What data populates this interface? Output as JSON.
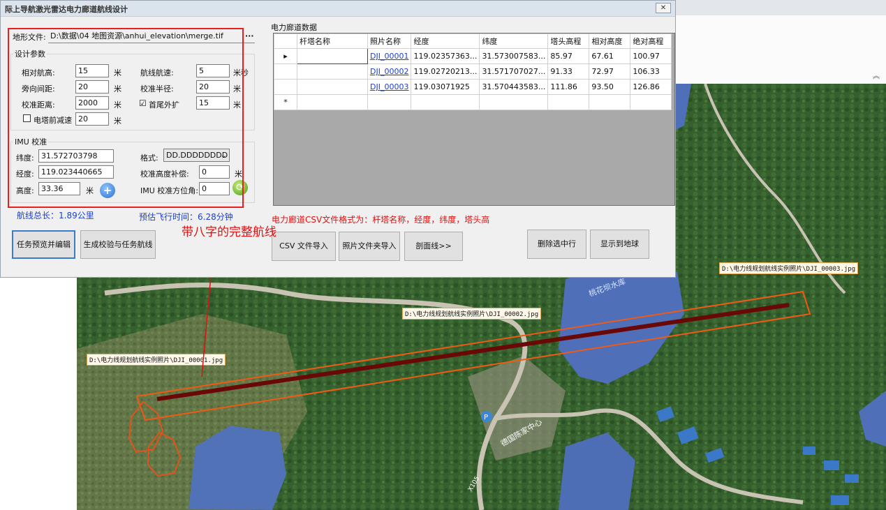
{
  "window": {
    "title": "际上导航激光雷达电力廊道航线设计",
    "close_label": "✕"
  },
  "terrain": {
    "label": "地形文件:",
    "path": "D:\\数据\\04 地图资源\\anhui_elevation\\merge.tif",
    "browse_label": "···"
  },
  "design": {
    "group_title": "设计参数",
    "rel_height_label": "相对航高:",
    "rel_height": "15",
    "rel_height_unit": "米",
    "speed_label": "航线航速:",
    "speed": "5",
    "speed_unit": "米秒",
    "side_spacing_label": "旁向间距:",
    "side_spacing": "20",
    "side_spacing_unit": "米",
    "calib_radius_label": "校准半径:",
    "calib_radius": "20",
    "calib_radius_unit": "米",
    "calib_dist_label": "校准距离:",
    "calib_dist": "2000",
    "calib_dist_unit": "米",
    "ext_label": "首尾外扩",
    "ext_checked": "☑",
    "ext_value": "15",
    "ext_unit": "米",
    "decel_label": "电塔前减速",
    "decel_value": "20",
    "decel_unit": "米"
  },
  "imu": {
    "group_title": "IMU 校准",
    "lat_label": "纬度:",
    "lat": "31.572703798",
    "lon_label": "经度:",
    "lon": "119.023440665",
    "alt_label": "高度:",
    "alt": "33.36",
    "alt_unit": "米",
    "format_label": "格式:",
    "format": "DD.DDDDDDDD",
    "alt_comp_label": "校准高度补偿:",
    "alt_comp": "0",
    "alt_comp_unit": "米",
    "heading_label": "IMU 校准方位角:",
    "heading": "0"
  },
  "summary": {
    "total_length": "航线总长：1.89公里",
    "est_time": "预估飞行时间：6.28分钟"
  },
  "buttons": {
    "preview": "任务预览并编辑",
    "generate": "生成校验与任务航线",
    "csv_import": "CSV 文件导入",
    "photo_import": "照片文件夹导入",
    "profile": "剖面线>>",
    "delete_row": "删除选中行",
    "show_globe": "显示到地球"
  },
  "grid": {
    "title": "电力廊道数据",
    "columns": [
      "杆塔名称",
      "照片名称",
      "经度",
      "纬度",
      "塔头高程",
      "相对高度",
      "绝对高程"
    ],
    "rows": [
      {
        "marker": "▸",
        "tower": "",
        "photo": "DJI_00001",
        "lon": "119.02357363...",
        "lat": "31.573007583...",
        "head": "85.97",
        "rel": "67.61",
        "abs": "100.97"
      },
      {
        "marker": "",
        "tower": "",
        "photo": "DJI_00002",
        "lon": "119.02720213...",
        "lat": "31.571707027...",
        "head": "91.33",
        "rel": "72.97",
        "abs": "106.33"
      },
      {
        "marker": "",
        "tower": "",
        "photo": "DJI_00003",
        "lon": "119.03071925",
        "lat": "31.570443583...",
        "head": "111.86",
        "rel": "93.50",
        "abs": "126.86"
      }
    ],
    "new_row_marker": "*"
  },
  "csv_note": "电力廊道CSV文件格式为：杆塔名称，经度，纬度，塔头高",
  "annotation": "带八字的完整航线",
  "map": {
    "photo_labels": [
      "D:\\电力线规划航线实例照片\\DJI_00001.jpg",
      "D:\\电力线规划航线实例照片\\DJI_00002.jpg",
      "D:\\电力线规划航线实例照片\\DJI_00003.jpg"
    ],
    "place_label": "德国陈家中心",
    "road_label": "X105",
    "lake_label": "桃花坝水库",
    "colors": {
      "route": "#7a0a0a",
      "corridor": "#f05a14",
      "forest": "#2f5a2a",
      "water": "#4f6fb8"
    }
  }
}
